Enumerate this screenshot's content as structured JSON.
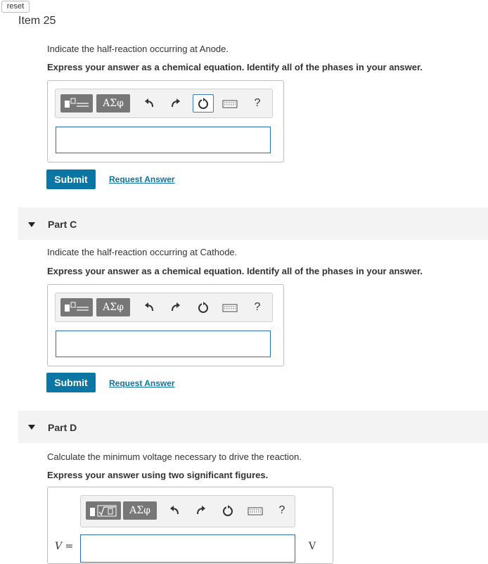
{
  "top": {
    "reset_label": "reset",
    "item_title": "Item 25"
  },
  "part_b": {
    "prompt": "Indicate the half-reaction occurring at Anode.",
    "instruction": "Express your answer as a chemical equation. Identify all of the phases in your answer.",
    "greek_label": "ΑΣφ",
    "help_label": "?",
    "submit_label": "Submit",
    "request_label": "Request Answer"
  },
  "part_c": {
    "title": "Part C",
    "prompt": "Indicate the half-reaction occurring at Cathode.",
    "instruction": "Express your answer as a chemical equation. Identify all of the phases in your answer.",
    "greek_label": "ΑΣφ",
    "help_label": "?",
    "submit_label": "Submit",
    "request_label": "Request Answer"
  },
  "part_d": {
    "title": "Part D",
    "prompt": "Calculate the minimum voltage necessary to drive the reaction.",
    "instruction": "Express your answer using two significant figures.",
    "greek_label": "ΑΣφ",
    "help_label": "?",
    "variable_label": "V =",
    "unit_label": "V"
  },
  "icons": [
    "templates-icon",
    "greek-letters-icon",
    "undo-icon",
    "redo-icon",
    "reset-icon",
    "keyboard-icon",
    "help-icon",
    "caret-down-icon"
  ],
  "colors": {
    "accent": "#0b76a4",
    "toolbar_button": "#777777",
    "input_border": "#2a6fa8",
    "part_bar": "#f3f3f3"
  }
}
